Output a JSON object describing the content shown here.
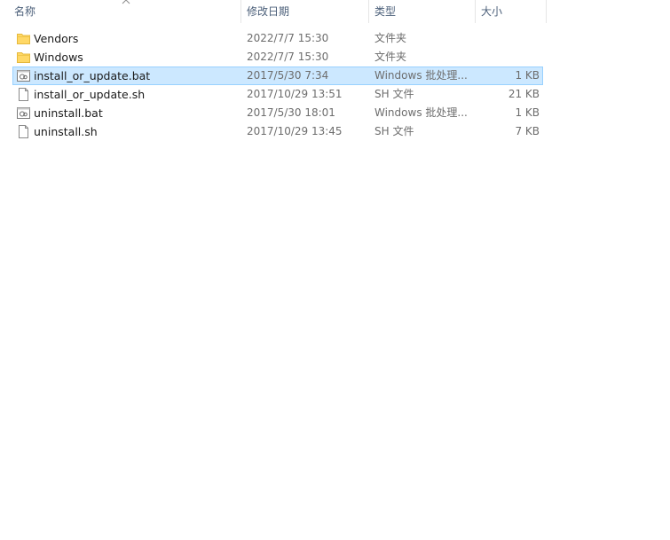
{
  "columns": {
    "name": "名称",
    "date": "修改日期",
    "type": "类型",
    "size": "大小"
  },
  "sort": {
    "column": "name",
    "direction": "ascending"
  },
  "files": [
    {
      "name": "Vendors",
      "date": "2022/7/7 15:30",
      "type": "文件夹",
      "size": "",
      "icon": "folder-icon",
      "selected": false
    },
    {
      "name": "Windows",
      "date": "2022/7/7 15:30",
      "type": "文件夹",
      "size": "",
      "icon": "folder-icon",
      "selected": false
    },
    {
      "name": "install_or_update.bat",
      "date": "2017/5/30 7:34",
      "type": "Windows 批处理...",
      "size": "1 KB",
      "icon": "batch-file-icon",
      "selected": true
    },
    {
      "name": "install_or_update.sh",
      "date": "2017/10/29 13:51",
      "type": "SH 文件",
      "size": "21 KB",
      "icon": "file-icon",
      "selected": false
    },
    {
      "name": "uninstall.bat",
      "date": "2017/5/30 18:01",
      "type": "Windows 批处理...",
      "size": "1 KB",
      "icon": "batch-file-icon",
      "selected": false
    },
    {
      "name": "uninstall.sh",
      "date": "2017/10/29 13:45",
      "type": "SH 文件",
      "size": "7 KB",
      "icon": "file-icon",
      "selected": false
    }
  ],
  "colors": {
    "selection_bg": "#cce8ff",
    "selection_border": "#99d1ff",
    "folder": "#ffd866",
    "header_text": "#4c607a"
  }
}
